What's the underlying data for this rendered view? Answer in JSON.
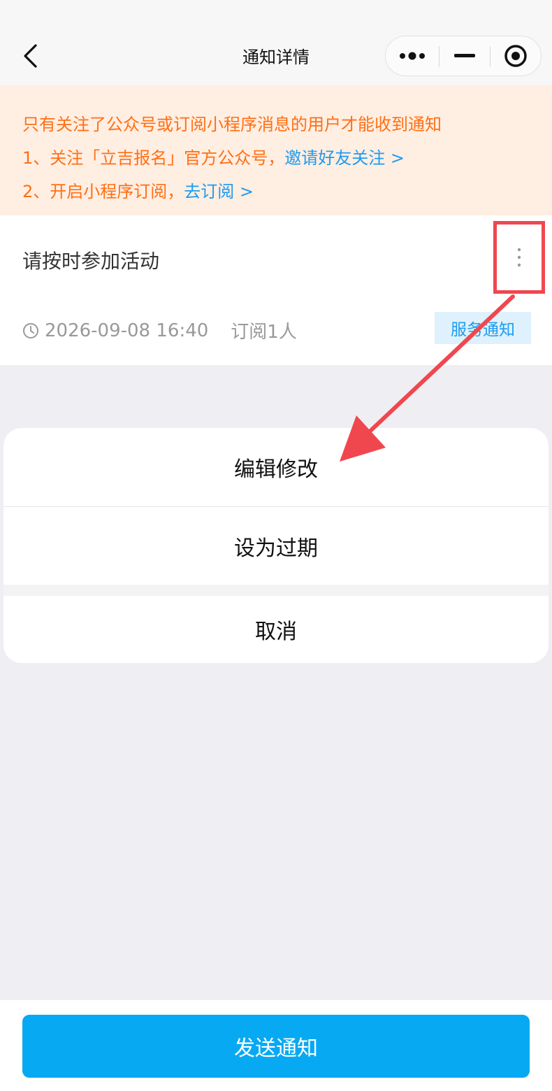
{
  "nav": {
    "title": "通知详情"
  },
  "banner": {
    "line1": "只有关注了公众号或订阅小程序消息的用户才能收到通知",
    "line2_text": "1、关注「立吉报名」官方公众号，",
    "line2_link": "邀请好友关注 >",
    "line3_text": "2、开启小程序订阅，",
    "line3_link": "去订阅 >"
  },
  "notification": {
    "title": "请按时参加活动",
    "datetime": "2026-09-08 16:40",
    "subscribers": "订阅1人",
    "tag": "服务通知"
  },
  "action_sheet": {
    "edit": "编辑修改",
    "expire": "设为过期",
    "cancel": "取消"
  },
  "footer": {
    "send_label": "发送通知"
  },
  "colors": {
    "banner_text": "#ff6f14",
    "link": "#1d9bef",
    "primary_button": "#07a9f3",
    "annotation": "#f0474f"
  }
}
